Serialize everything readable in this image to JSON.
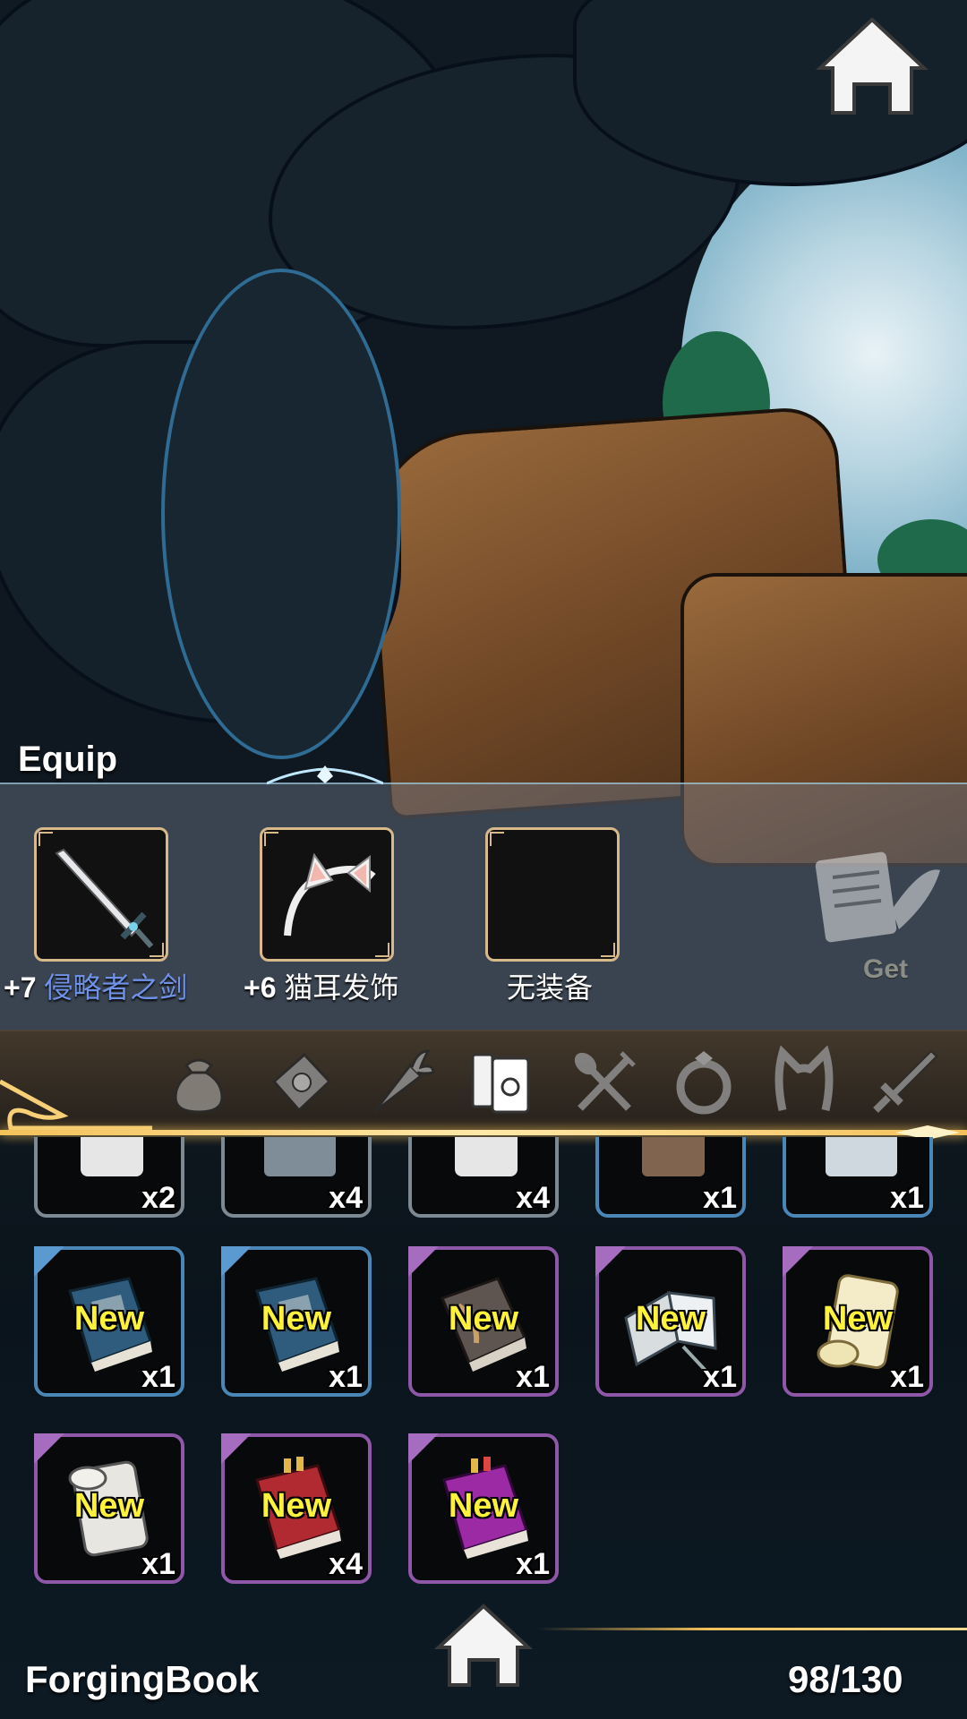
{
  "equip": {
    "title": "Equip",
    "slots": [
      {
        "level": "+7",
        "name": "侵略者之剑",
        "icon": "sword-icon"
      },
      {
        "level": "+6",
        "name": "猫耳发饰",
        "icon": "cat-ear-headband-icon"
      },
      {
        "level": "",
        "name": "无装备",
        "icon": ""
      }
    ],
    "get_label": "Get"
  },
  "categories": [
    {
      "icon": "bag-icon",
      "active": false
    },
    {
      "icon": "envelope-icon",
      "active": false
    },
    {
      "icon": "carrot-icon",
      "active": false
    },
    {
      "icon": "books-icon",
      "active": true
    },
    {
      "icon": "spoon-fork-icon",
      "active": false
    },
    {
      "icon": "ring-icon",
      "active": false
    },
    {
      "icon": "cat-ear-icon",
      "active": false
    },
    {
      "icon": "sword-icon",
      "active": false
    }
  ],
  "inventory": {
    "rows": [
      [
        {
          "qty": "x2",
          "new": "",
          "frame": "grey"
        },
        {
          "qty": "x4",
          "new": "",
          "frame": "grey"
        },
        {
          "qty": "x4",
          "new": "",
          "frame": "grey"
        },
        {
          "qty": "x1",
          "new": "",
          "frame": "blue"
        },
        {
          "qty": "x1",
          "new": "",
          "frame": "blue"
        }
      ],
      [
        {
          "qty": "x1",
          "new": "New",
          "frame": "blue",
          "icon": "blue-book-icon"
        },
        {
          "qty": "x1",
          "new": "New",
          "frame": "blue",
          "icon": "blue-book-icon"
        },
        {
          "qty": "x1",
          "new": "New",
          "frame": "purple",
          "icon": "grey-book-icon"
        },
        {
          "qty": "x1",
          "new": "New",
          "frame": "purple",
          "icon": "open-book-icon"
        },
        {
          "qty": "x1",
          "new": "New",
          "frame": "purple",
          "icon": "scroll-icon"
        }
      ],
      [
        {
          "qty": "x1",
          "new": "New",
          "frame": "purple",
          "icon": "scroll-icon"
        },
        {
          "qty": "x4",
          "new": "New",
          "frame": "purple",
          "icon": "red-book-icon"
        },
        {
          "qty": "x1",
          "new": "New",
          "frame": "purple",
          "icon": "magenta-book-icon"
        }
      ]
    ]
  },
  "footer": {
    "title": "ForgingBook",
    "count": "98/130"
  },
  "colors": {
    "accent_gold": "#f3c15a",
    "new_tag": "#fff23a",
    "frame_blue": "#4a87b6",
    "frame_purple": "#8e57a8",
    "equip_name_blue": "#6f92e8"
  }
}
